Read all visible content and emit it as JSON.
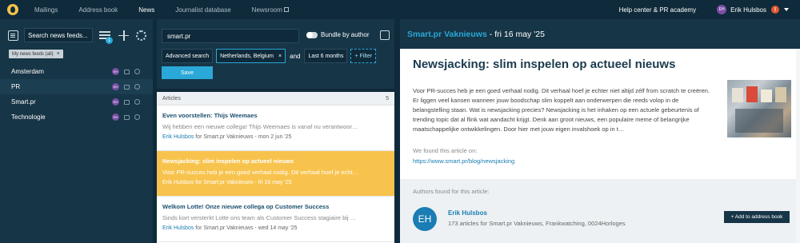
{
  "nav": {
    "items": [
      {
        "label": "Mailings"
      },
      {
        "label": "Address book"
      },
      {
        "label": "News"
      },
      {
        "label": "Journalist database"
      },
      {
        "label": "Newsroom"
      }
    ],
    "help": "Help center & PR academy",
    "user_initials": "EH",
    "user_name": "Erik Hulsbos",
    "alert": "!"
  },
  "sidebar": {
    "search_placeholder": "Search news feeds...",
    "filter_badge": "1",
    "chip_label": "My news feeds (all)",
    "chip_close": "×",
    "feeds": [
      {
        "label": "Amsterdam",
        "initials": "EH"
      },
      {
        "label": "PR",
        "initials": "EH"
      },
      {
        "label": "Smart.pr",
        "initials": "EH"
      },
      {
        "label": "Technologie",
        "initials": "EH"
      }
    ]
  },
  "search": {
    "query": "smart.pr",
    "bundle_label": "Bundle by author",
    "advanced": "Advanced search",
    "country": "Netherlands, Belgium",
    "country_close": "×",
    "and_label": "and",
    "period": "Last 6 months",
    "add_filter": "+ Filter",
    "save": "Save"
  },
  "articles": {
    "header": "Articles",
    "count": "5",
    "items": [
      {
        "title": "Even voorstellen: Thijs Weemaes",
        "snippet": "Wij hebben een nieuwe collega! Thijs Weemaes is vanaf nu verantwoor…",
        "author": "Erik Hulsbos",
        "meta": " for Smart.pr Vaknieuws - mon 2 jun '25"
      },
      {
        "title": "Newsjacking: slim inspelen op actueel nieuws",
        "snippet": "Voor PR-succes heb je een goed verhaal nodig. Dit verhaal hoef je echt…",
        "author": "Erik Hulsbos",
        "meta": " for Smart.pr Vaknieuws - fri 16 may '25"
      },
      {
        "title": "Welkom Lotte! Onze nieuwe collega op Customer Success",
        "snippet": "Sinds kort versterkt Lotte ons team als Customer Success stagiaire bij …",
        "author": "Erik Hulsbos",
        "meta": " for Smart.pr Vaknieuws - wed 14 may '25"
      }
    ]
  },
  "detail": {
    "source": "Smart.pr Vaknieuws",
    "date": "- fri 16 may '25",
    "title": "Newsjacking: slim inspelen op actueel nieuws",
    "body": "Voor PR-succes heb je een goed verhaal nodig. Dit verhaal hoef je echter niet altijd zélf from scratch te creëren. Er liggen veel kansen wanneer jouw boodschap slim koppelt aan onderwerpen die reeds volop in de belangstelling staan. Wat is newsjacking precies? Newsjacking is het inhaken op een actuele gebeurtenis of trending topic dat al flink wat aandacht krijgt. Denk aan groot nieuws, een populaire meme of belangrijke maatschappelijke ontwikkelingen. Door hier met jouw eigen invalshoek op in t…",
    "found_label": "We found this article on:",
    "link": "https://www.smart.pr/blog/newsjacking",
    "authors_header": "Authors found for this article:",
    "author_initials": "EH",
    "author_name": "Erik Hulsbos",
    "author_info": "173 articles for Smart.pr Vaknieuws, Frankwatching, 0024Horloges",
    "add_button": "+ Add to address book"
  }
}
